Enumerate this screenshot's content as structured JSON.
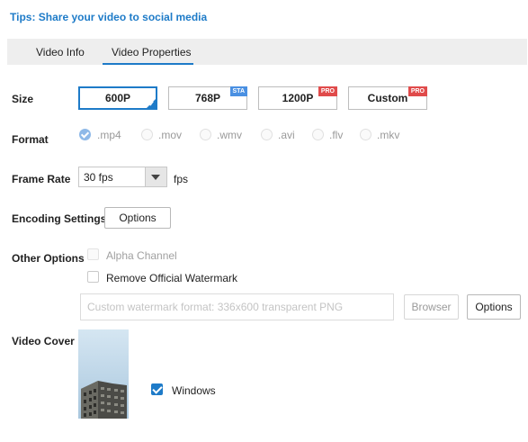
{
  "tips": "Tips: Share your video to social media",
  "tabs": [
    {
      "label": "Video Info",
      "active": false
    },
    {
      "label": "Video Properties",
      "active": true
    }
  ],
  "size": {
    "label": "Size",
    "options": [
      {
        "label": "600P",
        "badge": "",
        "selected": true
      },
      {
        "label": "768P",
        "badge": "STA",
        "selected": false
      },
      {
        "label": "1200P",
        "badge": "PRO",
        "selected": false
      },
      {
        "label": "Custom",
        "badge": "PRO",
        "selected": false
      }
    ]
  },
  "format": {
    "label": "Format",
    "options": [
      ".mp4",
      ".mov",
      ".wmv",
      ".avi",
      ".flv",
      ".mkv"
    ],
    "selected": ".mp4"
  },
  "frame_rate": {
    "label": "Frame Rate",
    "value": "30 fps",
    "unit": "fps"
  },
  "encoding": {
    "label": "Encoding Settings",
    "button": "Options"
  },
  "other_options": {
    "label": "Other Options",
    "alpha_channel": {
      "label": "Alpha Channel",
      "checked": false,
      "enabled": false
    },
    "remove_watermark": {
      "label": "Remove Official Watermark",
      "checked": false,
      "enabled": true
    },
    "watermark_placeholder": "Custom watermark format: 336x600 transparent PNG",
    "browser_button": "Browser",
    "options_button": "Options"
  },
  "video_cover": {
    "label": "Video Cover",
    "windows": {
      "label": "Windows",
      "checked": true
    }
  },
  "colors": {
    "accent": "#1e7bc8",
    "sta_badge": "#4a90e2",
    "pro_badge": "#e04b4b",
    "tab_bar": "#eeeeee"
  }
}
